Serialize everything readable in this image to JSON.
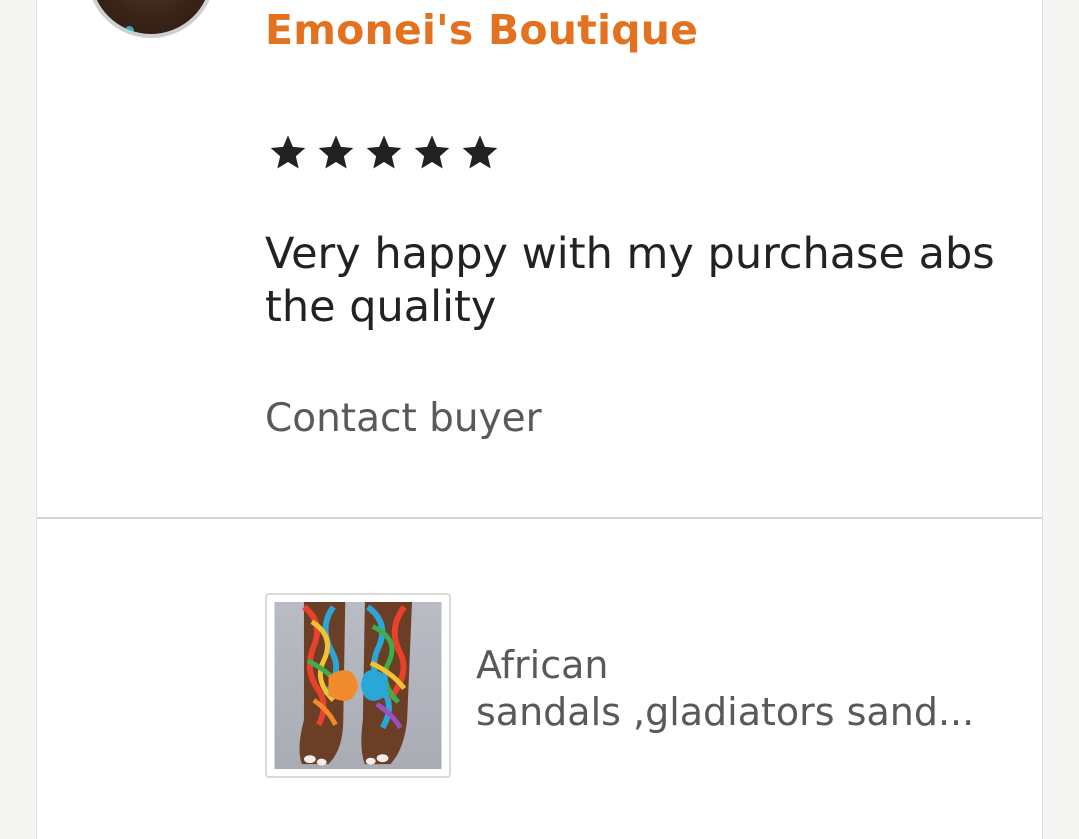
{
  "review": {
    "shop_name": "Emonei's Boutique",
    "rating": 5,
    "rating_max": 5,
    "text": "Very happy with my purchase abs the quality",
    "contact_label": "Contact buyer"
  },
  "product": {
    "title_line1": "African",
    "title_line2": "sandals ,gladiators sand..."
  },
  "colors": {
    "shop_name": "#e2721f",
    "star": "#222222",
    "background": "#f5f5f3"
  }
}
